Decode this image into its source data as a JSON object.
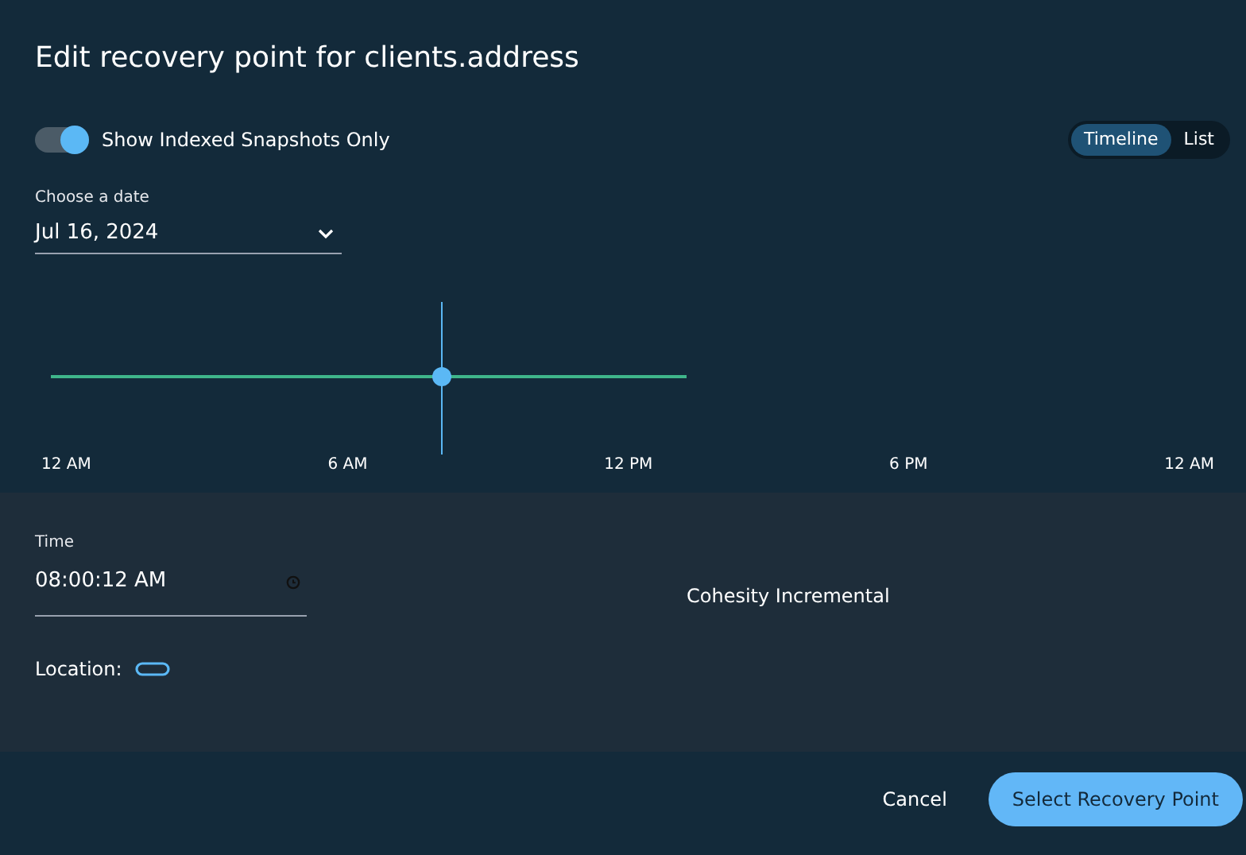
{
  "dialog": {
    "title": "Edit recovery point for clients.address"
  },
  "indexed_toggle": {
    "label": "Show Indexed Snapshots Only",
    "on": true
  },
  "view_tabs": [
    {
      "label": "Timeline",
      "selected": true
    },
    {
      "label": "List",
      "selected": false
    }
  ],
  "date_field": {
    "label": "Choose a date",
    "value": "Jul 16, 2024"
  },
  "timeline": {
    "axis_labels": [
      "12 AM",
      "6 AM",
      "12 PM",
      "6 PM",
      "12 AM"
    ]
  },
  "details": {
    "time_label": "Time",
    "time_value": "08:00:12 AM",
    "snapshot_type": "Cohesity Incremental",
    "location_label": "Location:"
  },
  "buttons": [
    {
      "label": "Cancel",
      "kind": "text"
    },
    {
      "label": "Select Recovery Point",
      "kind": "primary"
    }
  ]
}
